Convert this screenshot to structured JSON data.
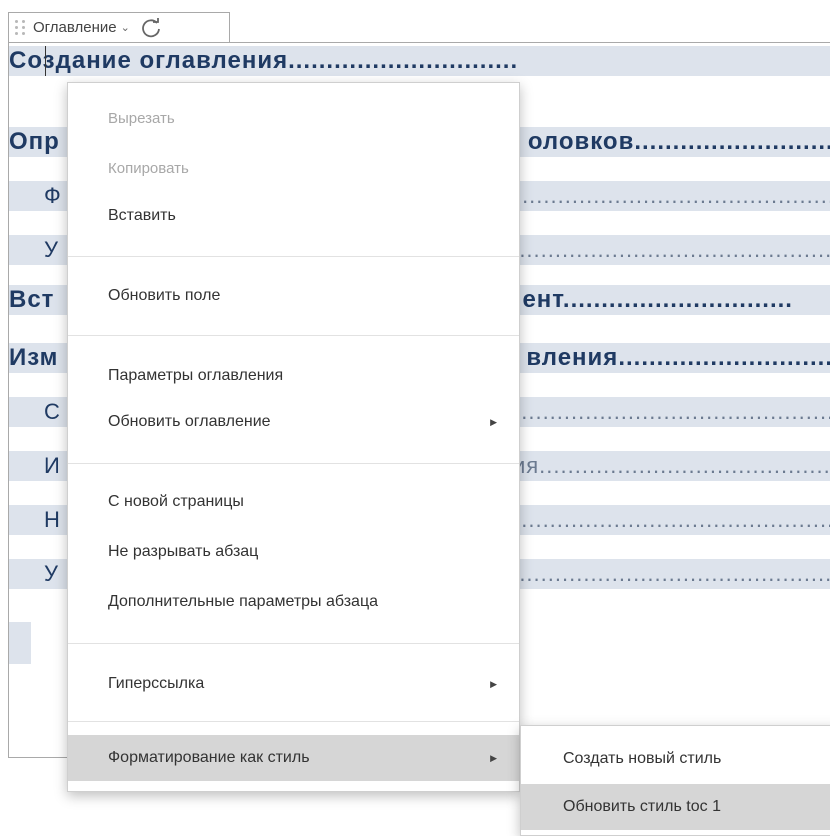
{
  "toc_control": {
    "label": "Оглавление",
    "dropdown_icon": "chevron-down-icon",
    "refresh_icon": "refresh-icon"
  },
  "toc_entries": [
    {
      "text": "Создание оглавления",
      "dots": "..............................",
      "level": 1
    },
    {
      "text": "Опр",
      "dots": "оловков..............................",
      "level": 1
    },
    {
      "text": "Ф",
      "dots": "..........................................................................",
      "level": 2
    },
    {
      "text": "У",
      "dots": "..........................................................................",
      "level": 2
    },
    {
      "text": "Вст",
      "dots": "ент..............................",
      "level": 1
    },
    {
      "text": "Изм",
      "dots": "вления..............................",
      "level": 1
    },
    {
      "text": "С",
      "dots": "..........................................................................",
      "level": 2
    },
    {
      "text": "И",
      "dots": "ния...............................................",
      "level": 2
    },
    {
      "text": "Н",
      "dots": "..........................................................................",
      "level": 2
    },
    {
      "text": "У",
      "dots": "..........................................................................",
      "level": 2
    }
  ],
  "context_menu": {
    "cut": "Вырезать",
    "copy": "Копировать",
    "paste": "Вставить",
    "update_field": "Обновить поле",
    "toc_settings": "Параметры оглавления",
    "update_toc": "Обновить оглавление",
    "page_break_before": "С новой страницы",
    "keep_lines_together": "Не разрывать абзац",
    "paragraph_advanced": "Дополнительные параметры абзаца",
    "hyperlink": "Гиперссылка",
    "format_as_style": "Форматирование как стиль"
  },
  "style_submenu": {
    "create_style": "Создать новый стиль",
    "update_style": "Обновить стиль toc 1"
  }
}
